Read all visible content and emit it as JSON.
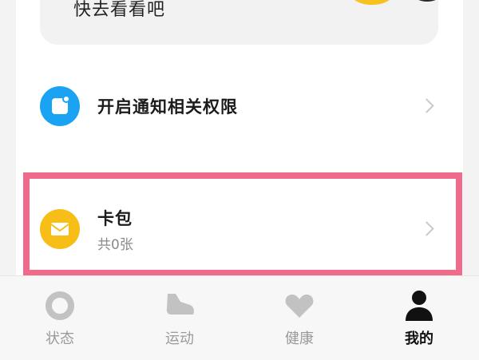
{
  "promo": {
    "text": "快去看看吧"
  },
  "notify_row": {
    "title": "开启通知相关权限",
    "icon": "notification-icon"
  },
  "card_row": {
    "title": "卡包",
    "subtitle": "共0张",
    "icon": "card-wallet-icon"
  },
  "tabs": [
    {
      "label": "状态",
      "icon": "ring-icon",
      "active": false
    },
    {
      "label": "运动",
      "icon": "shoe-icon",
      "active": false
    },
    {
      "label": "健康",
      "icon": "heart-icon",
      "active": false
    },
    {
      "label": "我的",
      "icon": "person-icon",
      "active": true
    }
  ],
  "colors": {
    "notify_icon_bg": "#1aa3f2",
    "card_icon_bg": "#f6be16",
    "highlight_border": "#f06a8c",
    "active_tab": "#111111",
    "inactive_tab": "#9a9a9a"
  }
}
